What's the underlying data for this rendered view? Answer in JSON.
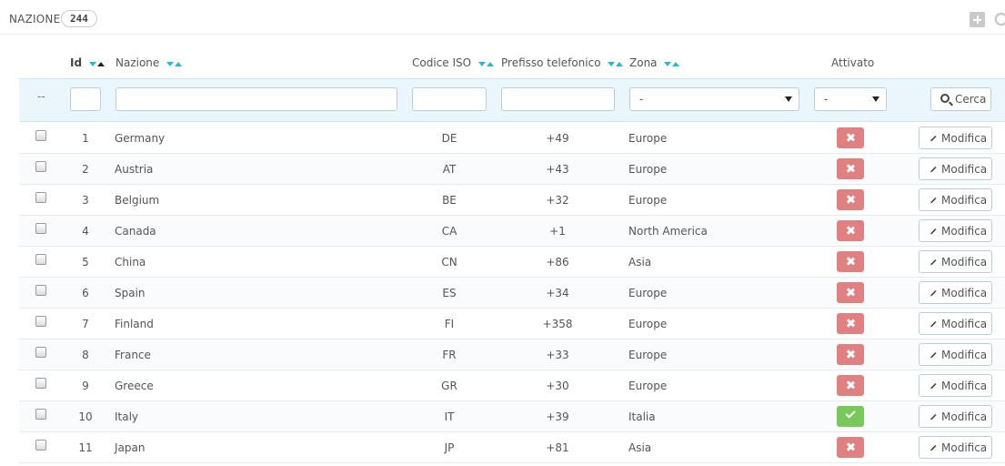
{
  "header": {
    "title": "NAZIONE",
    "count": "244",
    "add_icon": "plus-square-icon",
    "refresh_icon": "refresh-icon"
  },
  "columns": {
    "id": "Id",
    "name": "Nazione",
    "iso": "Codice ISO",
    "prefix": "Prefisso telefonico",
    "zone": "Zona",
    "active": "Attivato"
  },
  "filters": {
    "dashes": "--",
    "id_value": "",
    "name_value": "",
    "iso_value": "",
    "prefix_value": "",
    "zone_selected": "-",
    "active_selected": "-",
    "search_label": "Cerca"
  },
  "actions": {
    "edit_label": "Modifica"
  },
  "colors": {
    "accent": "#25b9d7",
    "inactive": "#e08080",
    "active": "#78c85a",
    "filter_bg": "#eaf6fb"
  },
  "rows": [
    {
      "id": "1",
      "name": "Germany",
      "iso": "DE",
      "prefix": "+49",
      "zone": "Europe",
      "active": false
    },
    {
      "id": "2",
      "name": "Austria",
      "iso": "AT",
      "prefix": "+43",
      "zone": "Europe",
      "active": false
    },
    {
      "id": "3",
      "name": "Belgium",
      "iso": "BE",
      "prefix": "+32",
      "zone": "Europe",
      "active": false
    },
    {
      "id": "4",
      "name": "Canada",
      "iso": "CA",
      "prefix": "+1",
      "zone": "North America",
      "active": false
    },
    {
      "id": "5",
      "name": "China",
      "iso": "CN",
      "prefix": "+86",
      "zone": "Asia",
      "active": false
    },
    {
      "id": "6",
      "name": "Spain",
      "iso": "ES",
      "prefix": "+34",
      "zone": "Europe",
      "active": false
    },
    {
      "id": "7",
      "name": "Finland",
      "iso": "FI",
      "prefix": "+358",
      "zone": "Europe",
      "active": false
    },
    {
      "id": "8",
      "name": "France",
      "iso": "FR",
      "prefix": "+33",
      "zone": "Europe",
      "active": false
    },
    {
      "id": "9",
      "name": "Greece",
      "iso": "GR",
      "prefix": "+30",
      "zone": "Europe",
      "active": false
    },
    {
      "id": "10",
      "name": "Italy",
      "iso": "IT",
      "prefix": "+39",
      "zone": "Italia",
      "active": true
    },
    {
      "id": "11",
      "name": "Japan",
      "iso": "JP",
      "prefix": "+81",
      "zone": "Asia",
      "active": false
    }
  ]
}
